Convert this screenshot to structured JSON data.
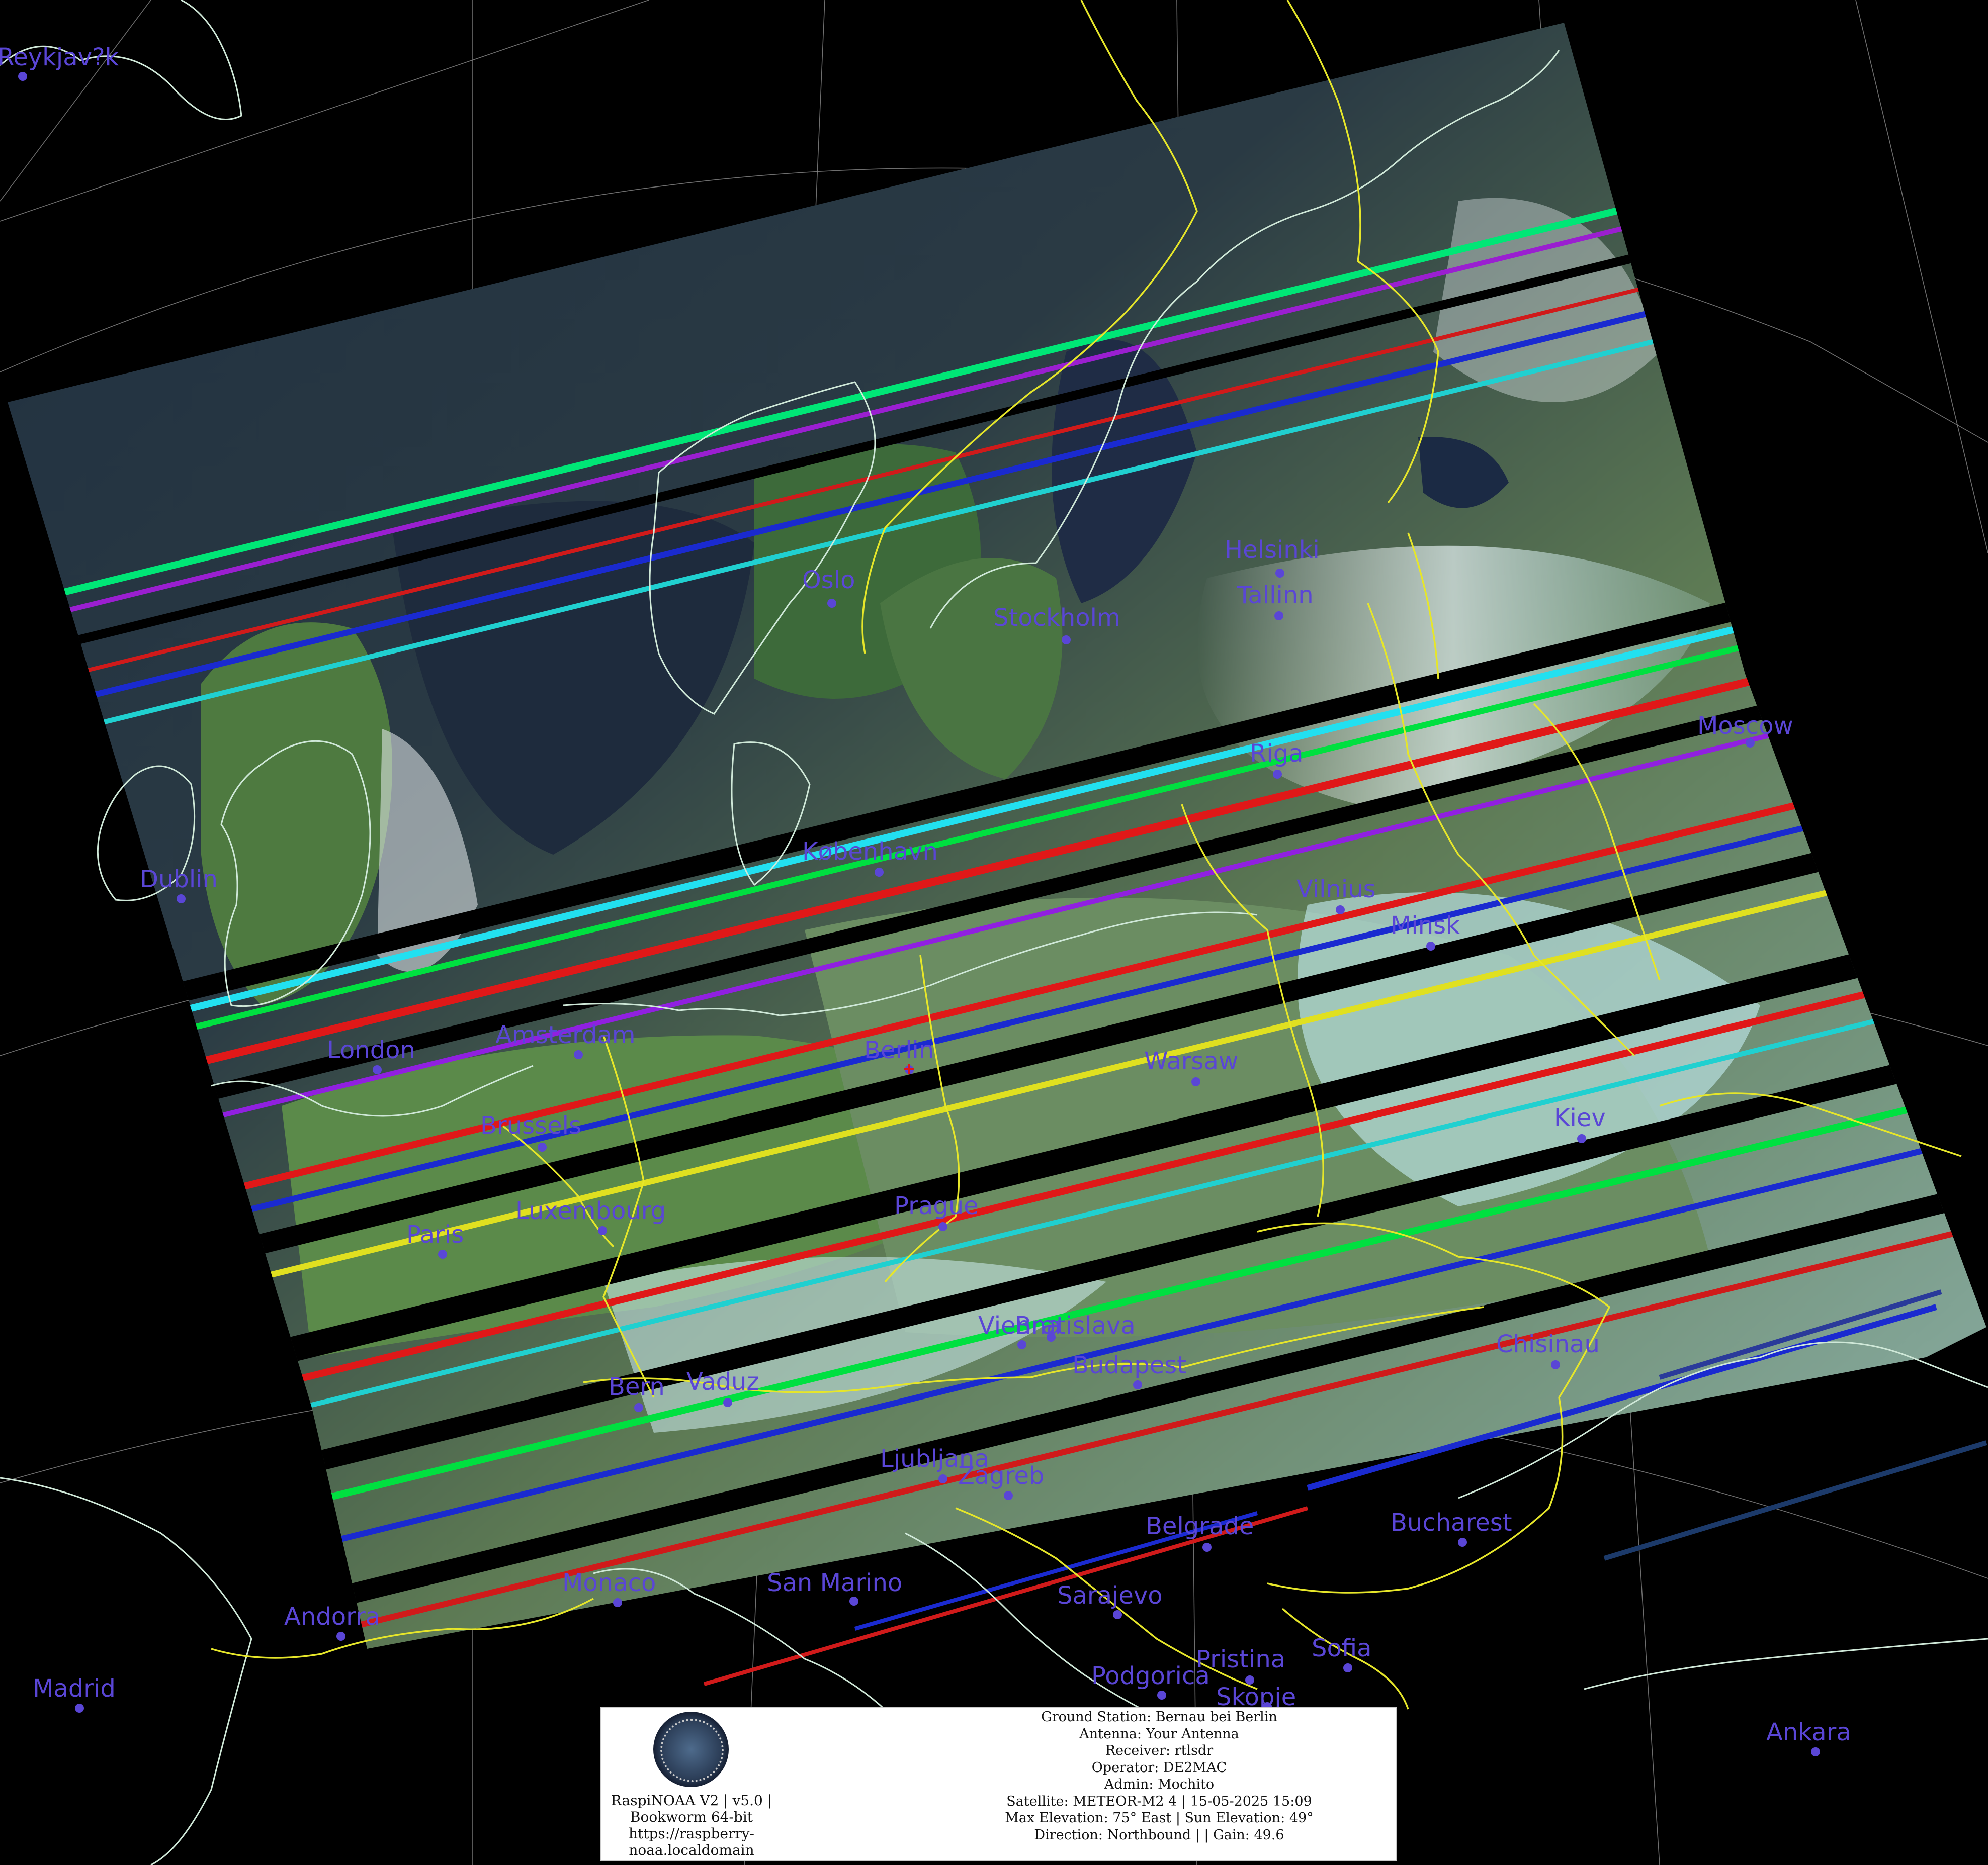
{
  "image": {
    "type": "satellite-composite-map",
    "colors": {
      "background": "#000000",
      "coastline": "#cfe8d8",
      "borders": "#e6e62a",
      "graticule": "#8a8a8a",
      "city_label": "#5a46d6"
    }
  },
  "cities": [
    {
      "name": "Reykjav?k",
      "id": "reykjavik"
    },
    {
      "name": "Helsinki",
      "id": "helsinki"
    },
    {
      "name": "Tallinn",
      "id": "tallinn"
    },
    {
      "name": "Oslo",
      "id": "oslo"
    },
    {
      "name": "Stockholm",
      "id": "stockholm"
    },
    {
      "name": "Riga",
      "id": "riga"
    },
    {
      "name": "Moscow",
      "id": "moscow"
    },
    {
      "name": "København",
      "id": "kobenhavn"
    },
    {
      "name": "Dublin",
      "id": "dublin"
    },
    {
      "name": "Vilnius",
      "id": "vilnius"
    },
    {
      "name": "Minsk",
      "id": "minsk"
    },
    {
      "name": "London",
      "id": "london"
    },
    {
      "name": "Amsterdam",
      "id": "amsterdam"
    },
    {
      "name": "Berlin",
      "id": "berlin"
    },
    {
      "name": "Warsaw",
      "id": "warsaw"
    },
    {
      "name": "Brussels",
      "id": "brussels"
    },
    {
      "name": "Kiev",
      "id": "kiev"
    },
    {
      "name": "Paris",
      "id": "paris"
    },
    {
      "name": "Luxembourg",
      "id": "luxembourg"
    },
    {
      "name": "Prague",
      "id": "prague"
    },
    {
      "name": "Vienna",
      "id": "vienna"
    },
    {
      "name": "Bratislava",
      "id": "bratislava"
    },
    {
      "name": "Budapest",
      "id": "budapest"
    },
    {
      "name": "Chisinau",
      "id": "chisinau"
    },
    {
      "name": "Bern",
      "id": "bern"
    },
    {
      "name": "Vaduz",
      "id": "vaduz"
    },
    {
      "name": "Ljubljana",
      "id": "ljubljana"
    },
    {
      "name": "Zagreb",
      "id": "zagreb"
    },
    {
      "name": "Belgrade",
      "id": "belgrade"
    },
    {
      "name": "Bucharest",
      "id": "bucharest"
    },
    {
      "name": "Monaco",
      "id": "monaco"
    },
    {
      "name": "San Marino",
      "id": "san-marino"
    },
    {
      "name": "Sarajevo",
      "id": "sarajevo"
    },
    {
      "name": "Andorra",
      "id": "andorra"
    },
    {
      "name": "Pristina",
      "id": "pristina"
    },
    {
      "name": "Sofia",
      "id": "sofia"
    },
    {
      "name": "Podgorica",
      "id": "podgorica"
    },
    {
      "name": "Skopje",
      "id": "skopje"
    },
    {
      "name": "Madrid",
      "id": "madrid"
    },
    {
      "name": "Ankara",
      "id": "ankara"
    }
  ],
  "info": {
    "software_lines": [
      "RaspiNOAA V2 | v5.0 |",
      "Bookworm 64-bit",
      "https://raspberry-",
      "noaa.localdomain"
    ],
    "station_lines": [
      "Ground Station: Bernau bei Berlin",
      "Antenna: Your Antenna",
      "Receiver: rtlsdr",
      "Operator: DE2MAC",
      "Admin: Mochito",
      "Satellite: METEOR-M2 4 | 15-05-2025 15:09",
      "Max Elevation: 75° East | Sun Elevation: 49°",
      "Direction: Northbound | | Gain: 49.6"
    ]
  }
}
